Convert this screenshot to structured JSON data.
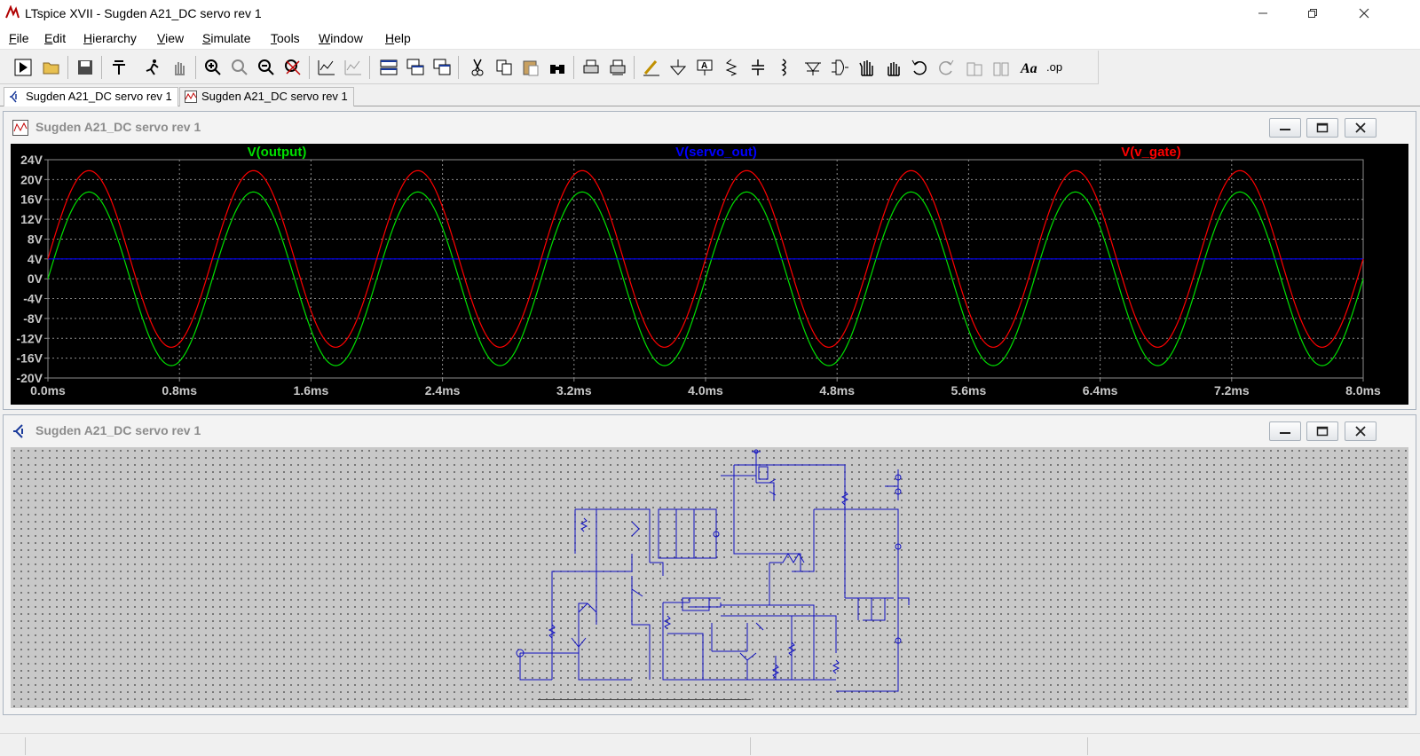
{
  "window": {
    "title": "LTspice XVII - Sugden A21_DC servo rev 1",
    "controls": [
      "minimize",
      "restore",
      "close"
    ]
  },
  "menu": [
    {
      "label": "File",
      "key": "F",
      "rest": "ile"
    },
    {
      "label": "Edit",
      "key": "E",
      "rest": "dit"
    },
    {
      "label": "Hierarchy",
      "key": "H",
      "rest": "ierarchy"
    },
    {
      "label": "View",
      "key": "V",
      "rest": "iew"
    },
    {
      "label": "Simulate",
      "key": "S",
      "rest": "imulate"
    },
    {
      "label": "Tools",
      "key": "T",
      "rest": "ools"
    },
    {
      "label": "Window",
      "key": "W",
      "rest": "indow"
    },
    {
      "label": "Help",
      "key": "H",
      "rest": "elp"
    }
  ],
  "toolbar_icons": [
    "run-icon",
    "open-icon",
    "save-icon",
    "control-panel-icon",
    "halt-icon",
    "pan-icon",
    "zoom-in-icon",
    "zoom-area-icon",
    "zoom-out-icon",
    "zoom-cancel-icon",
    "autorange-icon",
    "plot-settings-icon",
    "tile-horizontal-icon",
    "cascade-icon",
    "tile-vertical-icon",
    "cut-icon",
    "copy-icon",
    "paste-icon",
    "find-icon",
    "print-icon",
    "print-setup-icon",
    "wire-icon",
    "ground-icon",
    "label-icon",
    "resistor-icon",
    "capacitor-icon",
    "inductor-icon",
    "diode-icon",
    "component-icon",
    "move-icon",
    "drag-icon",
    "undo-icon",
    "redo-icon",
    "rotate-icon",
    "mirror-icon",
    "text-icon",
    "spice-directive-icon"
  ],
  "tabs": [
    {
      "label": "Sugden A21_DC servo rev 1",
      "active": true,
      "kind": "schematic"
    },
    {
      "label": "Sugden A21_DC servo rev 1",
      "active": false,
      "kind": "waveform"
    }
  ],
  "waveform_window": {
    "title": "Sugden A21_DC servo rev 1"
  },
  "schematic_window": {
    "title": "Sugden A21_DC servo rev 1"
  },
  "chart_data": {
    "type": "line",
    "title": "",
    "xlabel": "",
    "ylabel": "",
    "x_ticks": [
      "0.0ms",
      "0.8ms",
      "1.6ms",
      "2.4ms",
      "3.2ms",
      "4.0ms",
      "4.8ms",
      "5.6ms",
      "6.4ms",
      "7.2ms",
      "8.0ms"
    ],
    "y_ticks": [
      "24V",
      "20V",
      "16V",
      "12V",
      "8V",
      "4V",
      "0V",
      "-4V",
      "-8V",
      "-12V",
      "-16V",
      "-20V"
    ],
    "xlim": [
      0,
      8.0
    ],
    "ylim": [
      -20,
      24
    ],
    "grid": true,
    "background": "#000000",
    "series": [
      {
        "name": "V(output)",
        "color": "#00e000",
        "kind": "sine",
        "offset": 0,
        "amplitude": 17.5,
        "frequency_khz": 1.0,
        "phase_deg": 0
      },
      {
        "name": "V(servo_out)",
        "color": "#0000ff",
        "kind": "constant",
        "value": 4.0
      },
      {
        "name": "V(v_gate)",
        "color": "#ff0000",
        "kind": "sine",
        "offset": 4.0,
        "amplitude": 17.8,
        "frequency_khz": 1.0,
        "phase_deg": 0
      }
    ]
  }
}
